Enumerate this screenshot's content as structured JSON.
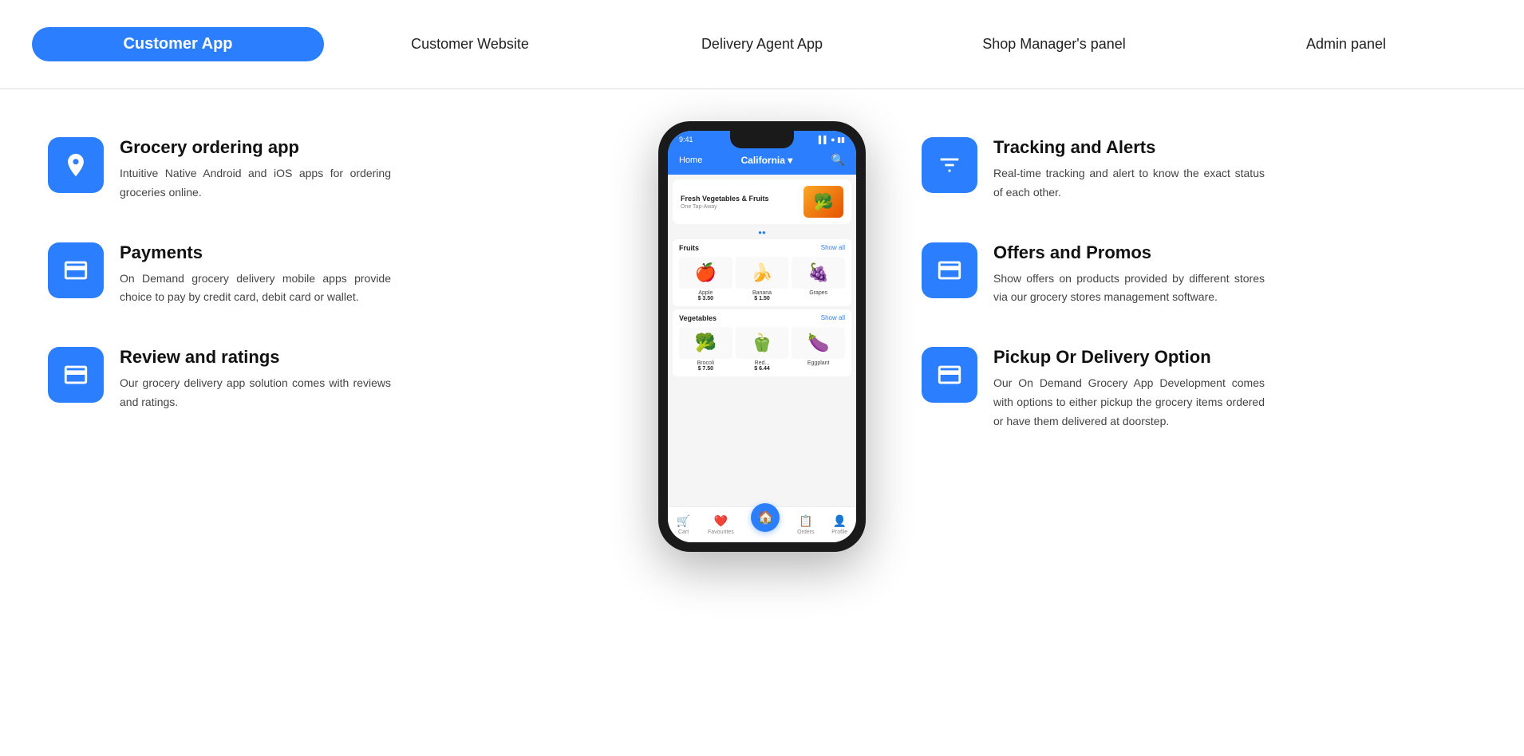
{
  "nav": {
    "tabs": [
      {
        "id": "customer-app",
        "label": "Customer App",
        "active": true
      },
      {
        "id": "customer-website",
        "label": "Customer Website",
        "active": false
      },
      {
        "id": "delivery-agent-app",
        "label": "Delivery Agent App",
        "active": false
      },
      {
        "id": "shop-managers-panel",
        "label": "Shop Manager's panel",
        "active": false
      },
      {
        "id": "admin-panel",
        "label": "Admin panel",
        "active": false
      }
    ]
  },
  "features_left": [
    {
      "id": "grocery-ordering",
      "icon": "location-pin",
      "title": "Grocery ordering app",
      "description": "Intuitive Native Android and iOS apps for ordering groceries online."
    },
    {
      "id": "payments",
      "icon": "payment-card",
      "title": "Payments",
      "description": "On Demand grocery delivery mobile apps provide choice to pay by credit card, debit card or wallet."
    },
    {
      "id": "review-ratings",
      "icon": "review-card",
      "title": "Review and ratings",
      "description": "Our grocery delivery app solution comes with reviews and ratings."
    }
  ],
  "features_right": [
    {
      "id": "tracking-alerts",
      "icon": "tracking",
      "title": "Tracking and Alerts",
      "description": "Real-time tracking and alert to know the exact status of each other."
    },
    {
      "id": "offers-promos",
      "icon": "offers",
      "title": "Offers and Promos",
      "description": "Show offers on products provided by different stores via our grocery stores management software."
    },
    {
      "id": "pickup-delivery",
      "icon": "pickup",
      "title": "Pickup Or Delivery Option",
      "description": "Our On Demand Grocery App Development comes with options to either pickup the grocery items ordered or have them delivered at doorstep."
    }
  ],
  "phone": {
    "status_time": "9:41",
    "header_home": "Home",
    "header_location": "California",
    "banner_title": "Fresh Vegetables & Fruits",
    "banner_sub": "One Tap-Away",
    "fruits_section": "Fruits",
    "vegetables_section": "Vegetables",
    "show_all": "Show all",
    "products_fruits": [
      {
        "name": "Apple",
        "price": "$ 3.50",
        "emoji": "🍎"
      },
      {
        "name": "Banana",
        "price": "$ 1.50",
        "emoji": "🍌"
      },
      {
        "name": "Grapes",
        "price": "",
        "emoji": "🍇"
      }
    ],
    "products_vegetables": [
      {
        "name": "Brocoli",
        "price": "$ 7.50",
        "emoji": "🥦"
      },
      {
        "name": "Red...",
        "price": "$ 6.44",
        "emoji": "🫑"
      },
      {
        "name": "Eggplant",
        "price": "",
        "emoji": "🍆"
      }
    ],
    "nav_items": [
      "Cart",
      "Favourites",
      "Home",
      "Orders",
      "Profile"
    ],
    "nav_icons": [
      "🛒",
      "❤️",
      "🏠",
      "📋",
      "👤"
    ]
  }
}
